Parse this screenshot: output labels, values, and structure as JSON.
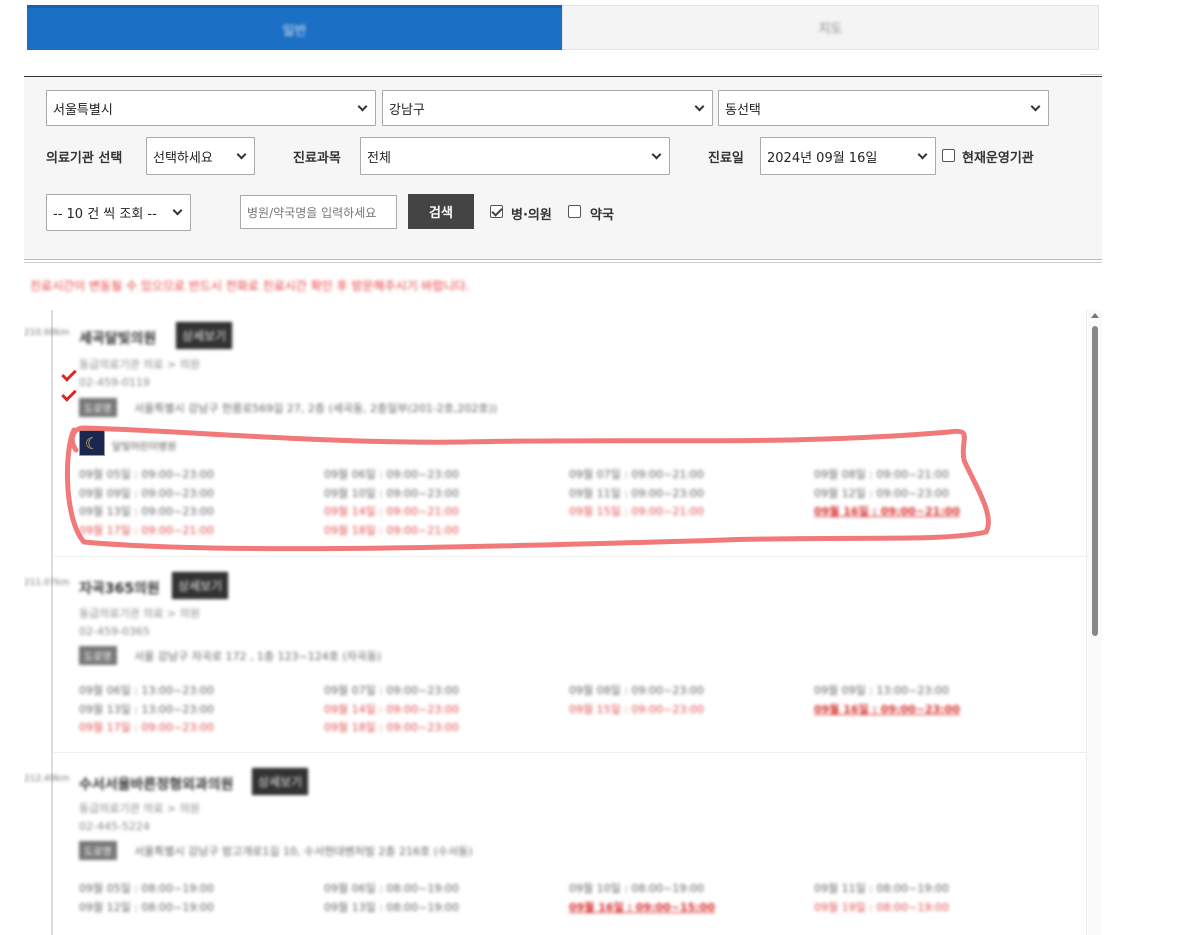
{
  "tabs": [
    {
      "label": "일반",
      "active": true
    },
    {
      "label": "지도",
      "active": false
    }
  ],
  "filters": {
    "city": "서울특별시",
    "district": "강남구",
    "dong": "동선택",
    "facility_label": "의료기관 선택",
    "facility_value": "선택하세요",
    "dept_label": "진료과목",
    "dept_value": "전체",
    "date_label": "진료일",
    "date_value": "2024년 09월 16일",
    "operating_label": "현재운영기관",
    "page_size": "-- 10 건 씩 조회 --",
    "search_placeholder": "병원/약국명을 입력하세요",
    "search_button": "검색",
    "hospital_label": "병·의원",
    "hospital_checked": true,
    "pharmacy_label": "약국",
    "pharmacy_checked": false
  },
  "notice": "진료시간이 변동될 수 있으므로 반드시 전화로 진료시간 확인 후 방문해주시기 바랍니다.",
  "detail_label": "상세보기",
  "address_tag": "도로명",
  "night_label": "달빛어린이병원",
  "entries": [
    {
      "distance": "210.68km",
      "name": "세곡달빛의원",
      "type": "동급의료기관 의료 > 의원",
      "phone": "02-459-0119",
      "address": "서울특별시 강남구 헌릉로569길 27, 2층 (세곡동, 2층일부(201-2호,202호))",
      "schedule": [
        {
          "text": "09월 05일 : 09:00~23:00",
          "style": "normal"
        },
        {
          "text": "09월 06일 : 09:00~23:00",
          "style": "normal"
        },
        {
          "text": "09월 07일 : 09:00~21:00",
          "style": "normal"
        },
        {
          "text": "09월 08일 : 09:00~21:00",
          "style": "normal"
        },
        {
          "text": "09월 09일 : 09:00~23:00",
          "style": "normal"
        },
        {
          "text": "09월 10일 : 09:00~23:00",
          "style": "normal"
        },
        {
          "text": "09월 11일 : 09:00~23:00",
          "style": "normal"
        },
        {
          "text": "09월 12일 : 09:00~23:00",
          "style": "normal"
        },
        {
          "text": "09월 13일 : 09:00~23:00",
          "style": "normal"
        },
        {
          "text": "09월 14일 : 09:00~21:00",
          "style": "red"
        },
        {
          "text": "09월 15일 : 09:00~21:00",
          "style": "red"
        },
        {
          "text": "09월 16일 : 09:00~21:00",
          "style": "today"
        },
        {
          "text": "09월 17일 : 09:00~21:00",
          "style": "red"
        },
        {
          "text": "09월 18일 : 09:00~21:00",
          "style": "red"
        }
      ]
    },
    {
      "distance": "211.07km",
      "name": "자곡365의원",
      "type": "동급의료기관 의료 > 의원",
      "phone": "02-459-0365",
      "address": "서울 강남구 자곡로 172 , 1층 123~124호 (자곡동)",
      "schedule": [
        {
          "text": "09월 06일 : 13:00~23:00",
          "style": "normal"
        },
        {
          "text": "09월 07일 : 09:00~23:00",
          "style": "normal"
        },
        {
          "text": "09월 08일 : 09:00~23:00",
          "style": "normal"
        },
        {
          "text": "09월 09일 : 13:00~23:00",
          "style": "normal"
        },
        {
          "text": "09월 13일 : 13:00~23:00",
          "style": "normal"
        },
        {
          "text": "09월 14일 : 09:00~23:00",
          "style": "red"
        },
        {
          "text": "09월 15일 : 09:00~23:00",
          "style": "red"
        },
        {
          "text": "09월 16일 : 09:00~23:00",
          "style": "today"
        },
        {
          "text": "09월 17일 : 09:00~23:00",
          "style": "red"
        },
        {
          "text": "09월 18일 : 09:00~23:00",
          "style": "red"
        }
      ]
    },
    {
      "distance": "212.49km",
      "name": "수서서울바른정형외과의원",
      "type": "동급의료기관 의료 > 의원",
      "phone": "02-445-5224",
      "address": "서울특별시 강남구 밤고개로1길 10, 수서현대벤처빌 2층 216호 (수서동)",
      "schedule": [
        {
          "text": "09월 05일 : 08:00~19:00",
          "style": "normal"
        },
        {
          "text": "09월 06일 : 08:00~19:00",
          "style": "normal"
        },
        {
          "text": "09월 10일 : 08:00~19:00",
          "style": "normal"
        },
        {
          "text": "09월 11일 : 08:00~19:00",
          "style": "normal"
        },
        {
          "text": "09월 12일 : 08:00~19:00",
          "style": "normal"
        },
        {
          "text": "09월 13일 : 08:00~19:00",
          "style": "normal"
        },
        {
          "text": "09월 16일 : 09:00~15:00",
          "style": "today"
        },
        {
          "text": "09월 19일 : 08:00~19:00",
          "style": "red"
        }
      ]
    }
  ]
}
